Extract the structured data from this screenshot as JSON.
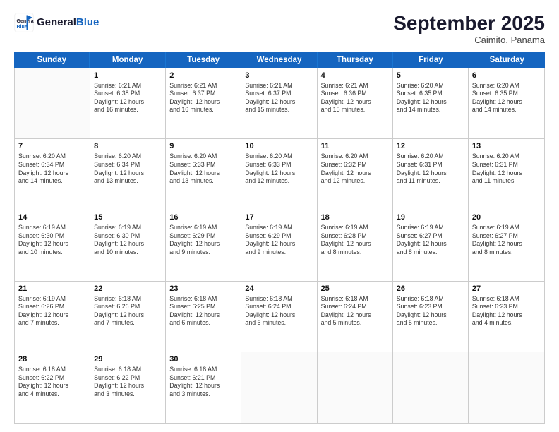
{
  "header": {
    "logo_line1": "General",
    "logo_line2": "Blue",
    "month": "September 2025",
    "location": "Caimito, Panama"
  },
  "weekdays": [
    "Sunday",
    "Monday",
    "Tuesday",
    "Wednesday",
    "Thursday",
    "Friday",
    "Saturday"
  ],
  "rows": [
    [
      {
        "day": "",
        "info": ""
      },
      {
        "day": "1",
        "info": "Sunrise: 6:21 AM\nSunset: 6:38 PM\nDaylight: 12 hours\nand 16 minutes."
      },
      {
        "day": "2",
        "info": "Sunrise: 6:21 AM\nSunset: 6:37 PM\nDaylight: 12 hours\nand 16 minutes."
      },
      {
        "day": "3",
        "info": "Sunrise: 6:21 AM\nSunset: 6:37 PM\nDaylight: 12 hours\nand 15 minutes."
      },
      {
        "day": "4",
        "info": "Sunrise: 6:21 AM\nSunset: 6:36 PM\nDaylight: 12 hours\nand 15 minutes."
      },
      {
        "day": "5",
        "info": "Sunrise: 6:20 AM\nSunset: 6:35 PM\nDaylight: 12 hours\nand 14 minutes."
      },
      {
        "day": "6",
        "info": "Sunrise: 6:20 AM\nSunset: 6:35 PM\nDaylight: 12 hours\nand 14 minutes."
      }
    ],
    [
      {
        "day": "7",
        "info": "Sunrise: 6:20 AM\nSunset: 6:34 PM\nDaylight: 12 hours\nand 14 minutes."
      },
      {
        "day": "8",
        "info": "Sunrise: 6:20 AM\nSunset: 6:34 PM\nDaylight: 12 hours\nand 13 minutes."
      },
      {
        "day": "9",
        "info": "Sunrise: 6:20 AM\nSunset: 6:33 PM\nDaylight: 12 hours\nand 13 minutes."
      },
      {
        "day": "10",
        "info": "Sunrise: 6:20 AM\nSunset: 6:33 PM\nDaylight: 12 hours\nand 12 minutes."
      },
      {
        "day": "11",
        "info": "Sunrise: 6:20 AM\nSunset: 6:32 PM\nDaylight: 12 hours\nand 12 minutes."
      },
      {
        "day": "12",
        "info": "Sunrise: 6:20 AM\nSunset: 6:31 PM\nDaylight: 12 hours\nand 11 minutes."
      },
      {
        "day": "13",
        "info": "Sunrise: 6:20 AM\nSunset: 6:31 PM\nDaylight: 12 hours\nand 11 minutes."
      }
    ],
    [
      {
        "day": "14",
        "info": "Sunrise: 6:19 AM\nSunset: 6:30 PM\nDaylight: 12 hours\nand 10 minutes."
      },
      {
        "day": "15",
        "info": "Sunrise: 6:19 AM\nSunset: 6:30 PM\nDaylight: 12 hours\nand 10 minutes."
      },
      {
        "day": "16",
        "info": "Sunrise: 6:19 AM\nSunset: 6:29 PM\nDaylight: 12 hours\nand 9 minutes."
      },
      {
        "day": "17",
        "info": "Sunrise: 6:19 AM\nSunset: 6:29 PM\nDaylight: 12 hours\nand 9 minutes."
      },
      {
        "day": "18",
        "info": "Sunrise: 6:19 AM\nSunset: 6:28 PM\nDaylight: 12 hours\nand 8 minutes."
      },
      {
        "day": "19",
        "info": "Sunrise: 6:19 AM\nSunset: 6:27 PM\nDaylight: 12 hours\nand 8 minutes."
      },
      {
        "day": "20",
        "info": "Sunrise: 6:19 AM\nSunset: 6:27 PM\nDaylight: 12 hours\nand 8 minutes."
      }
    ],
    [
      {
        "day": "21",
        "info": "Sunrise: 6:19 AM\nSunset: 6:26 PM\nDaylight: 12 hours\nand 7 minutes."
      },
      {
        "day": "22",
        "info": "Sunrise: 6:18 AM\nSunset: 6:26 PM\nDaylight: 12 hours\nand 7 minutes."
      },
      {
        "day": "23",
        "info": "Sunrise: 6:18 AM\nSunset: 6:25 PM\nDaylight: 12 hours\nand 6 minutes."
      },
      {
        "day": "24",
        "info": "Sunrise: 6:18 AM\nSunset: 6:24 PM\nDaylight: 12 hours\nand 6 minutes."
      },
      {
        "day": "25",
        "info": "Sunrise: 6:18 AM\nSunset: 6:24 PM\nDaylight: 12 hours\nand 5 minutes."
      },
      {
        "day": "26",
        "info": "Sunrise: 6:18 AM\nSunset: 6:23 PM\nDaylight: 12 hours\nand 5 minutes."
      },
      {
        "day": "27",
        "info": "Sunrise: 6:18 AM\nSunset: 6:23 PM\nDaylight: 12 hours\nand 4 minutes."
      }
    ],
    [
      {
        "day": "28",
        "info": "Sunrise: 6:18 AM\nSunset: 6:22 PM\nDaylight: 12 hours\nand 4 minutes."
      },
      {
        "day": "29",
        "info": "Sunrise: 6:18 AM\nSunset: 6:22 PM\nDaylight: 12 hours\nand 3 minutes."
      },
      {
        "day": "30",
        "info": "Sunrise: 6:18 AM\nSunset: 6:21 PM\nDaylight: 12 hours\nand 3 minutes."
      },
      {
        "day": "",
        "info": ""
      },
      {
        "day": "",
        "info": ""
      },
      {
        "day": "",
        "info": ""
      },
      {
        "day": "",
        "info": ""
      }
    ]
  ]
}
